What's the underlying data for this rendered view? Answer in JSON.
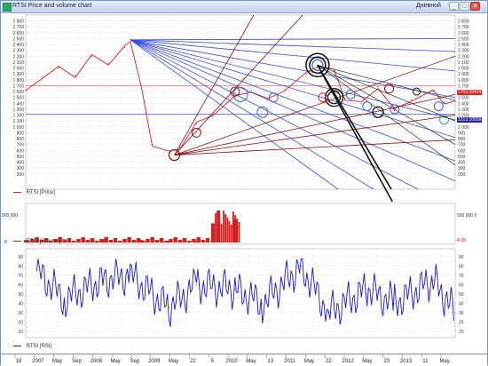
{
  "window": {
    "title": "RTSI Price and volume chart",
    "period": "Дневной",
    "buttons": {
      "min": "_",
      "max": "□",
      "close": "✕"
    }
  },
  "colors": {
    "price": "#d81e1e",
    "rsi": "#1a1acc",
    "blue_line": "#3a4ed8",
    "dark_red_line": "#8b1010",
    "grid": "#bcc9dc"
  },
  "price_pane": {
    "legend": "RTSI [Price]",
    "badge_red": "1703.39424",
    "badge_blue": "1213.10559"
  },
  "volume_pane": {
    "legend": "RTSI [Volume]",
    "left_label": "000 000",
    "right_label": "500 000 0",
    "zero_left": "0",
    "zero_right": "4 28"
  },
  "rsi_pane": {
    "legend": "RTSI [RSI]"
  },
  "chart_data": [
    {
      "type": "line",
      "name": "RTSI [Price]",
      "x_range": [
        "2006-11",
        "2013-05"
      ],
      "ylim": [
        0,
        2900
      ],
      "y_ticks": [
        2800,
        2700,
        2600,
        2500,
        2400,
        2300,
        2200,
        2100,
        2000,
        1900,
        1800,
        1700,
        1600,
        1500,
        1400,
        1300,
        1200,
        1100,
        1000,
        900,
        800,
        700,
        600,
        500,
        400,
        300,
        200
      ],
      "y_ticks_right": [
        2800,
        2700,
        2600,
        2500,
        2400,
        2300,
        2200,
        2100,
        2000,
        1900,
        1800,
        1700,
        1600,
        1500,
        1400,
        1300,
        1200,
        1100,
        1000,
        900,
        800,
        700,
        600,
        500,
        400,
        300,
        200
      ],
      "x": [
        "2006-11",
        "2007-02",
        "2007-05",
        "2007-08",
        "2007-11",
        "2008-02",
        "2008-05",
        "2008-06",
        "2008-08",
        "2008-10",
        "2009-01",
        "2009-03",
        "2009-06",
        "2009-09",
        "2010-01",
        "2010-04",
        "2010-07",
        "2010-10",
        "2011-02",
        "2011-04",
        "2011-07",
        "2011-09",
        "2011-12",
        "2012-03",
        "2012-06",
        "2012-09",
        "2013-01",
        "2013-03",
        "2013-05"
      ],
      "values": [
        1620,
        1850,
        2000,
        1870,
        2200,
        2080,
        2350,
        2480,
        1650,
        700,
        560,
        650,
        1050,
        1220,
        1500,
        1620,
        1450,
        1640,
        1900,
        2050,
        1950,
        1480,
        1400,
        1680,
        1280,
        1460,
        1600,
        1420,
        1440
      ],
      "grid": true
    },
    {
      "type": "bar",
      "name": "RTSI [Volume]",
      "x": [
        "2006-11",
        "2007-06",
        "2008-01",
        "2008-08",
        "2009-01",
        "2009-06",
        "2009-09",
        "2009-10",
        "2010-01"
      ],
      "values": [
        0.08,
        0.1,
        0.1,
        0.08,
        0.06,
        0.05,
        0.6,
        1.0,
        0.7
      ],
      "note_units": "relative to max"
    },
    {
      "type": "line",
      "name": "RTSI [RSI]",
      "ylim": [
        5,
        95
      ],
      "y_ticks": [
        90,
        80,
        70,
        60,
        50,
        40,
        30,
        20,
        10
      ],
      "y_ticks_right": [
        90,
        80,
        70,
        60,
        50,
        40,
        30,
        20,
        10
      ],
      "x": [
        "2007-01",
        "2007-06",
        "2008-01",
        "2008-06",
        "2009-01",
        "2009-06",
        "2010-01",
        "2010-06",
        "2011-01",
        "2011-06",
        "2012-01",
        "2012-06",
        "2013-01",
        "2013-05"
      ],
      "values": [
        75,
        45,
        65,
        70,
        35,
        60,
        55,
        40,
        80,
        30,
        55,
        40,
        65,
        30
      ]
    }
  ],
  "time_axis": {
    "labels": [
      "18",
      "2007",
      "May",
      "Sep",
      "2008",
      "May",
      "Sep",
      "2009",
      "May",
      "22",
      "5",
      "2010",
      "May",
      "13",
      "2011",
      "May",
      "22",
      "2012",
      "May",
      "23",
      "2013",
      "11",
      "May"
    ]
  }
}
